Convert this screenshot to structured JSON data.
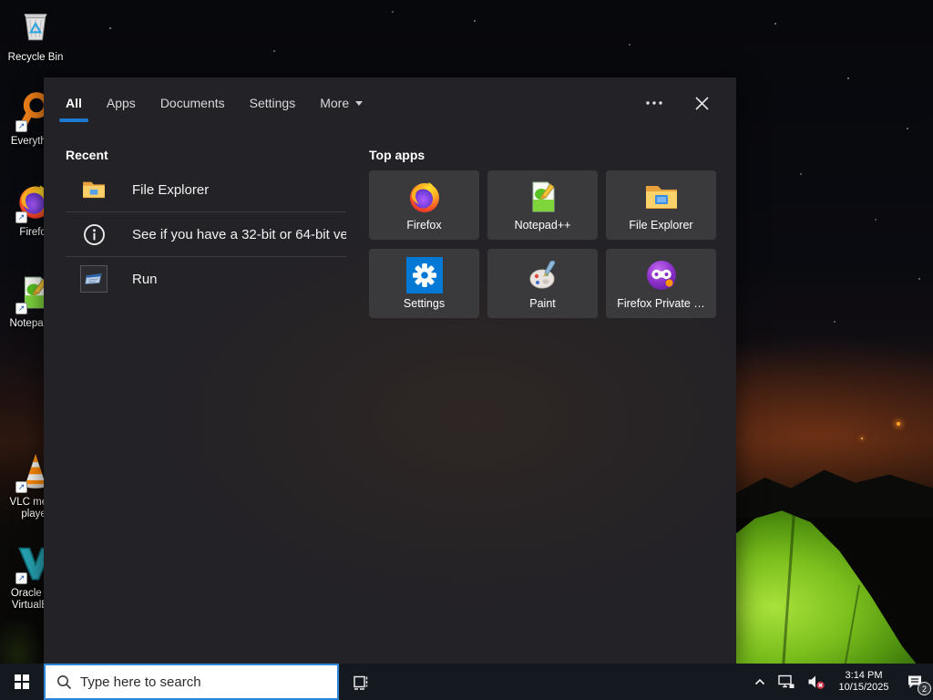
{
  "desktop": {
    "icons": [
      {
        "label": "Recycle Bin",
        "icon": "recycle-bin"
      },
      {
        "label": "Everything",
        "icon": "everything"
      },
      {
        "label": "Firefox",
        "icon": "firefox"
      },
      {
        "label": "Notepad++",
        "icon": "notepad-plus-plus"
      },
      {
        "label": "VLC media player",
        "icon": "vlc"
      },
      {
        "label": "Oracle VM VirtualBox",
        "icon": "virtualbox"
      }
    ]
  },
  "search_panel": {
    "tabs": [
      {
        "label": "All",
        "active": true
      },
      {
        "label": "Apps"
      },
      {
        "label": "Documents"
      },
      {
        "label": "Settings"
      },
      {
        "label": "More",
        "has_dropdown": true
      }
    ],
    "recent": {
      "header": "Recent",
      "items": [
        {
          "label": "File Explorer",
          "icon": "file-explorer"
        },
        {
          "label": "See if you have a 32-bit or 64-bit ve…",
          "icon": "info"
        },
        {
          "label": "Run",
          "icon": "run"
        }
      ]
    },
    "top_apps": {
      "header": "Top apps",
      "items": [
        {
          "label": "Firefox",
          "icon": "firefox"
        },
        {
          "label": "Notepad++",
          "icon": "notepad-plus-plus"
        },
        {
          "label": "File Explorer",
          "icon": "file-explorer"
        },
        {
          "label": "Settings",
          "icon": "settings"
        },
        {
          "label": "Paint",
          "icon": "paint"
        },
        {
          "label": "Firefox Private …",
          "icon": "firefox-private"
        }
      ]
    }
  },
  "taskbar": {
    "search_placeholder": "Type here to search",
    "clock": {
      "time": "3:14 PM",
      "date": "10/15/2025"
    },
    "notification_badge": "2"
  },
  "colors": {
    "accent": "#1e7ad1",
    "panel_bg": "#232226",
    "tile_bg": "#3a3a3d",
    "taskbar_bg": "#141920",
    "tent_green": "#7cc01e"
  }
}
